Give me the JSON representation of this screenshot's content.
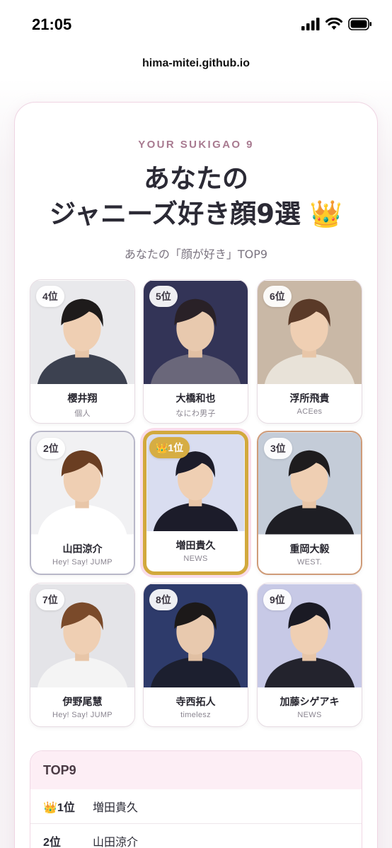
{
  "status_bar": {
    "time": "21:05"
  },
  "browser": {
    "url": "hima-mitei.github.io"
  },
  "header": {
    "eyebrow": "YOUR SUKIGAO 9",
    "title_line1": "あなたの",
    "title_line2": "ジャニーズ好き顔9選 👑",
    "subtitle": "あなたの「顔が好き」TOP9"
  },
  "grid": [
    {
      "rank": "4位",
      "name": "櫻井翔",
      "group": "個人",
      "bg": "#e9e9ec"
    },
    {
      "rank": "5位",
      "name": "大橋和也",
      "group": "なにわ男子",
      "bg": "#35365a"
    },
    {
      "rank": "6位",
      "name": "浮所飛貴",
      "group": "ACEes",
      "bg": "#c9b8a6"
    },
    {
      "rank": "2位",
      "name": "山田涼介",
      "group": "Hey! Say! JUMP",
      "bg": "#f1f1f3"
    },
    {
      "rank": "👑1位",
      "name": "増田貴久",
      "group": "NEWS",
      "bg": "#d9ddf0"
    },
    {
      "rank": "3位",
      "name": "重岡大毅",
      "group": "WEST.",
      "bg": "#c4ccd8"
    },
    {
      "rank": "7位",
      "name": "伊野尾慧",
      "group": "Hey! Say! JUMP",
      "bg": "#e4e4e8"
    },
    {
      "rank": "8位",
      "name": "寺西拓人",
      "group": "timelesz",
      "bg": "#2f3d6e"
    },
    {
      "rank": "9位",
      "name": "加藤シゲアキ",
      "group": "NEWS",
      "bg": "#c7c9e6"
    }
  ],
  "top9": {
    "heading": "TOP9",
    "rows": [
      {
        "rank": "👑1位",
        "name": "増田貴久"
      },
      {
        "rank": "2位",
        "name": "山田涼介"
      }
    ]
  }
}
